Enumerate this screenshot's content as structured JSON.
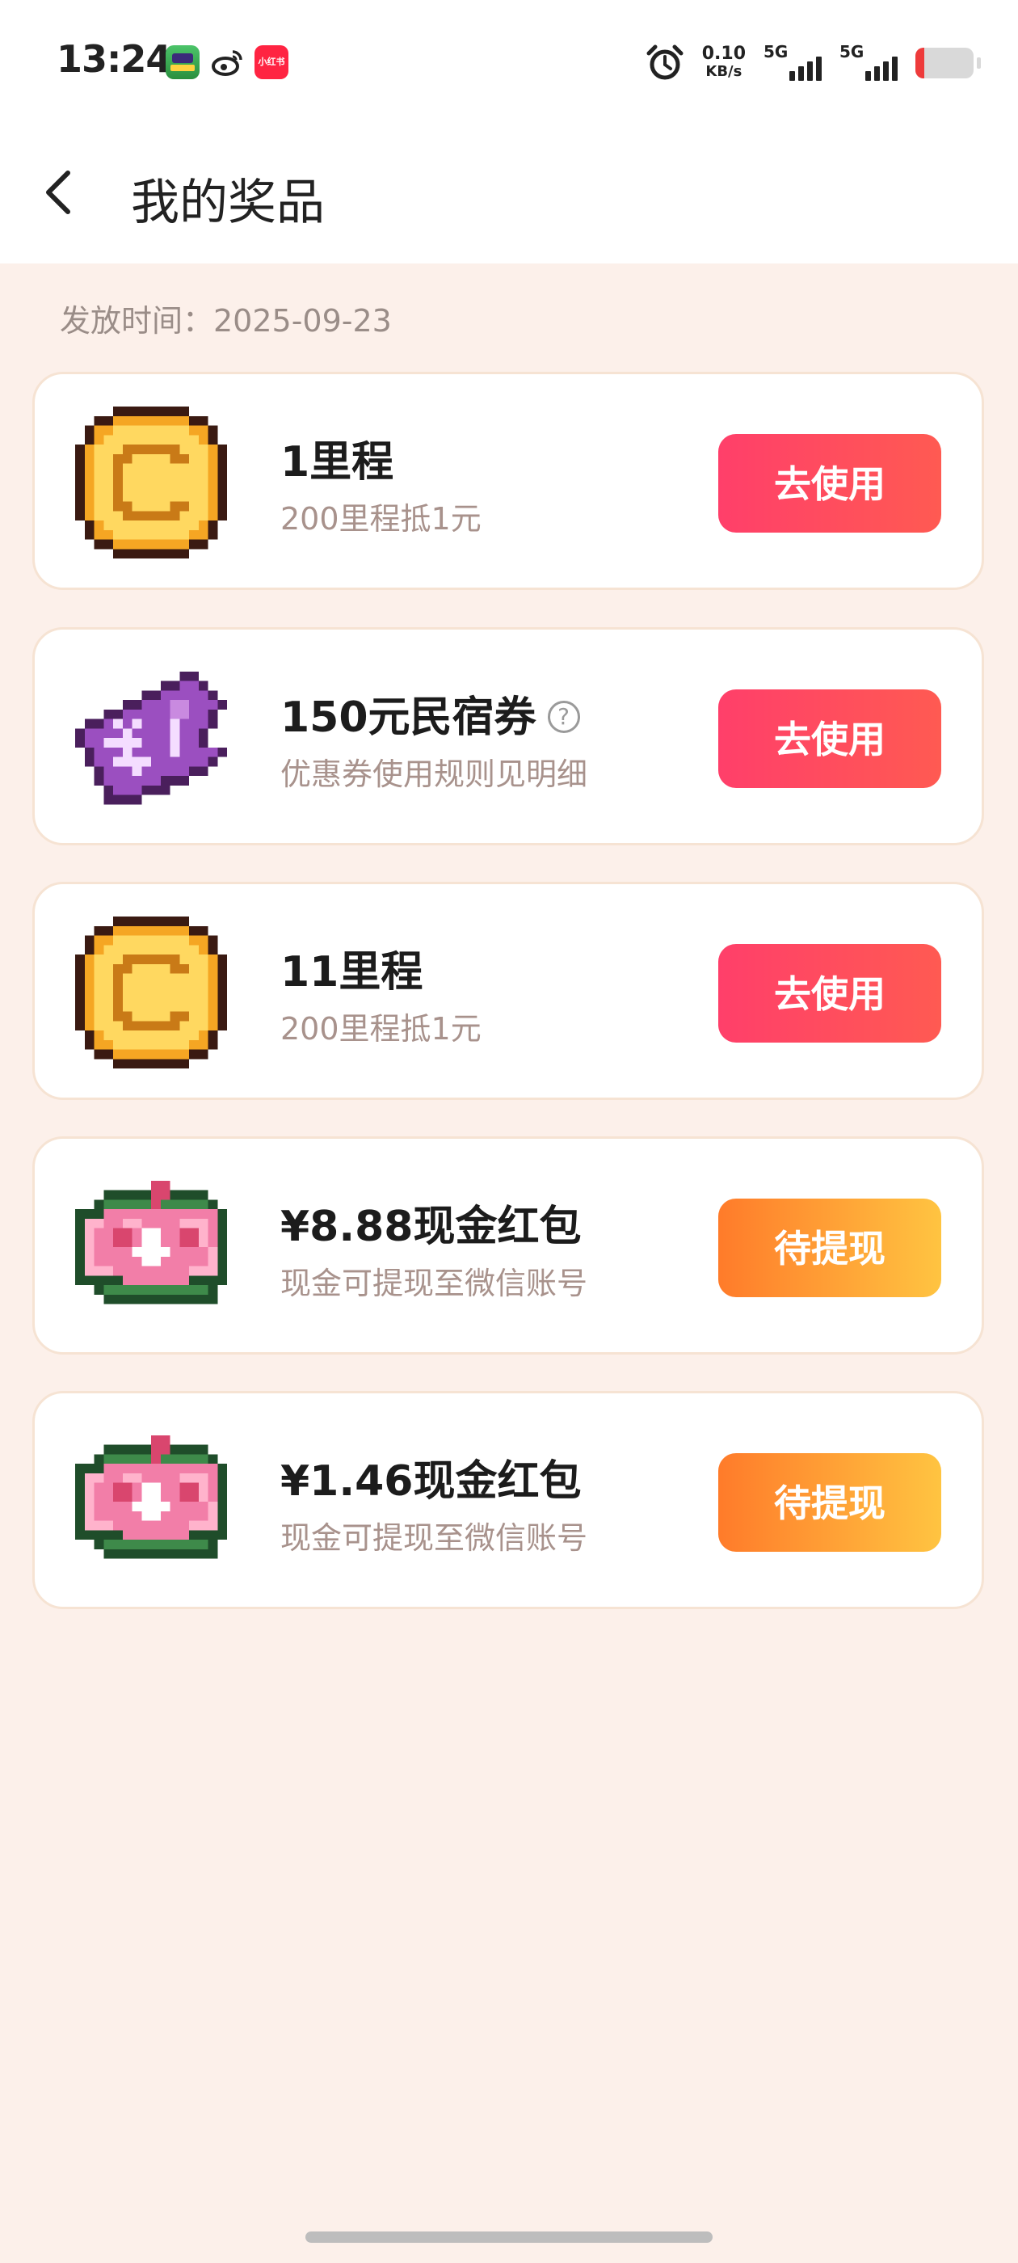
{
  "status_bar": {
    "time": "13:24",
    "net_speed_value": "0.10",
    "net_speed_unit": "KB/s",
    "sim1": "5G",
    "sim2": "5G",
    "icons": [
      "game-app-icon",
      "weibo-icon",
      "xiaohongshu-icon",
      "alarm-icon",
      "signal-icon",
      "battery-icon"
    ],
    "xiaohongshu_label": "小红书",
    "battery_level": 0.15
  },
  "nav": {
    "title": "我的奖品"
  },
  "issue_date": "发放时间：2025-09-23",
  "prizes": [
    {
      "name": "1里程",
      "desc": "200里程抵1元",
      "button": "去使用",
      "icon": "coin-icon",
      "button_type": "use"
    },
    {
      "name": "150元民宿券",
      "desc": "优惠券使用规则见明细",
      "button": "去使用",
      "icon": "ticket-icon",
      "button_type": "use",
      "help": "?"
    },
    {
      "name": "11里程",
      "desc": "200里程抵1元",
      "button": "去使用",
      "icon": "coin-icon",
      "button_type": "use"
    },
    {
      "name": "¥8.88现金红包",
      "desc": "现金可提现至微信账号",
      "button": "待提现",
      "icon": "cash-icon",
      "button_type": "cash"
    },
    {
      "name": "¥1.46现金红包",
      "desc": "现金可提现至微信账号",
      "button": "待提现",
      "icon": "cash-icon",
      "button_type": "cash"
    }
  ],
  "colors": {
    "page_bg": "#fcf0ea",
    "use_button": "#ff3f6a",
    "cash_button": "#ff9a33",
    "coin": "#f6b53c",
    "ticket": "#9b4fc0",
    "cash_note": "#f07aa2"
  },
  "pixel_art": {
    "coin": {
      "palette": {
        "k": "#3a1a12",
        "o": "#f5a623",
        "y": "#ffd860",
        "d": "#c97a17"
      },
      "rows": [
        "....kkkkkkkk....",
        "..kkooooooookk..",
        ".kooyyyyyyyyook.",
        ".koyyyyyyyyyyok.",
        "koyyyddddddyyyok",
        "koyyddyyyyddyyok",
        "koyydyyyyyyyyyok",
        "koyydyyyyyyyyyok",
        "koyydyyyyyyyyyok",
        "koyydyyyyyyyyyok",
        "koyyddyyyyddyyok",
        "koyyyddddddyyyok",
        ".koyyyyyyyyyyok.",
        ".kooyyyyyyyyook.",
        "..kkooooooookk..",
        "....kkkkkkkk...."
      ]
    },
    "ticket": {
      "palette": {
        "k": "#4a1f5c",
        "p": "#9b4fc0",
        "l": "#c98ae0",
        "w": "#f4ddff"
      },
      "rows": [
        "................",
        "...........kk...",
        ".........kkppk..",
        ".......kkpppppk.",
        ".....kkpppllpppk",
        "...kkpppppllppk.",
        ".kkpwpwpppwpppk.",
        "kppppwppppwppk..",
        "kppwwwwpppwppk..",
        ".kpppwppppwppppk",
        ".kppwwwwppppppk.",
        "..kpppwpppppkk..",
        "..kppppppkkk....",
        "...kpppkkk......",
        "...kkkk.........",
        "................"
      ]
    },
    "cash": {
      "palette": {
        "g": "#1f4d2a",
        "m": "#3e8a4a",
        "p": "#f27ea8",
        "q": "#ffb3cc",
        "r": "#d9466e",
        "w": "#ffffff"
      },
      "rows": [
        "................",
        "........rr......",
        "...gggggrrgggg..",
        "..gmmmmmrmmmmmg.",
        "gggppppppppppppg",
        "gqqppqqppppqqqpg",
        "gqpprrpwwpprrqpg",
        "gqpprrpwwpprrqpg",
        "gqppppwwwwppppqg",
        "gqpppppwwpppppqg",
        "gqqqppppppppqqqg",
        "gggggpppppppgggg",
        "..gmmmmmmmmmmmg.",
        "...gggggggggggg.",
        "................",
        "................"
      ]
    }
  }
}
